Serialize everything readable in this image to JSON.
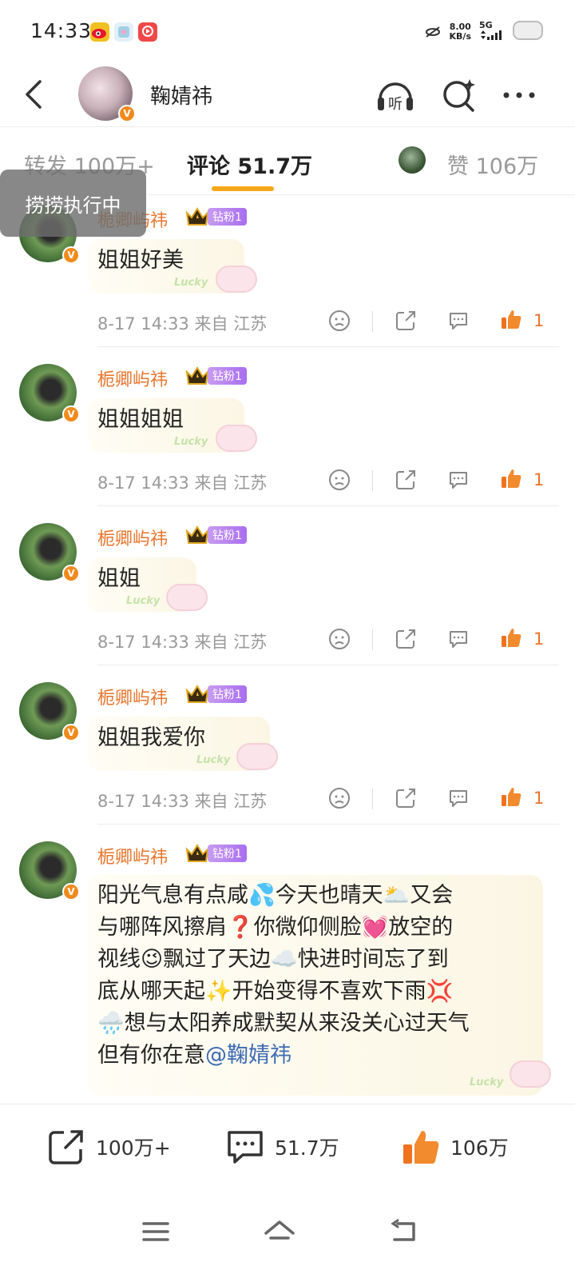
{
  "status_bar": {
    "time": "14:33",
    "net_speed_value": "8.00",
    "net_speed_unit": "KB/s",
    "network": "5G"
  },
  "header": {
    "title": "鞠婧祎",
    "listen_label": "听"
  },
  "tabs": {
    "repost": "转发 100万+",
    "comments": "评论 51.7万",
    "likes": "赞 106万"
  },
  "toast": "捞捞执行中",
  "comments": [
    {
      "user": "栀卿屿祎",
      "fan_badge": "钻粉1",
      "text": "姐姐好美",
      "time": "8-17 14:33",
      "location": "来自 江苏",
      "likes": "1"
    },
    {
      "user": "栀卿屿祎",
      "fan_badge": "钻粉1",
      "text": "姐姐姐姐",
      "time": "8-17 14:33",
      "location": "来自 江苏",
      "likes": "1"
    },
    {
      "user": "栀卿屿祎",
      "fan_badge": "钻粉1",
      "text": "姐姐",
      "time": "8-17 14:33",
      "location": "来自 江苏",
      "likes": "1"
    },
    {
      "user": "栀卿屿祎",
      "fan_badge": "钻粉1",
      "text": "姐姐我爱你",
      "time": "8-17 14:33",
      "location": "来自 江苏",
      "likes": "1"
    },
    {
      "user": "栀卿屿祎",
      "fan_badge": "钻粉1",
      "lines": [
        "阳光气息有点咸💦今天也晴天🌥️又会",
        "与哪阵风擦肩❓你微仰侧脸💓放空的",
        "视线😉飘过了天边☁️快进时间忘了到",
        "底从哪天起✨开始变得不喜欢下雨💢",
        "🌧️想与太阳养成默契从来没关心过天气"
      ],
      "last_line_prefix": "但有你在意",
      "mention": "@鞠婧祎"
    }
  ],
  "bubble_text": "Lucky",
  "bottom_bar": {
    "repost_count": "100万+",
    "comment_count": "51.7万",
    "like_count": "106万"
  },
  "colors": {
    "accent_orange": "#f4a71a",
    "username_orange": "#e8742a",
    "mention_blue": "#3d6bb3",
    "fan_badge_purple": "#a86ef0"
  }
}
